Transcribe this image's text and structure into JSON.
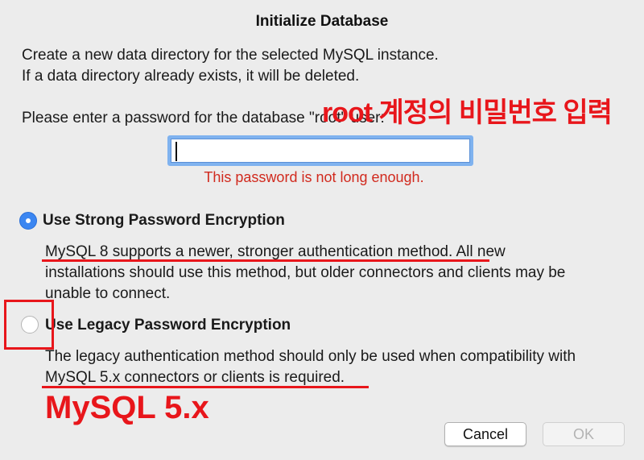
{
  "dialog": {
    "title": "Initialize Database",
    "description_line1": "Create a new data directory for the selected MySQL instance.",
    "description_line2": "If a data directory already exists, it will be deleted.",
    "password_label": "Please enter a password for the database \"root\" user:",
    "password_value": "",
    "password_error": "This password is not long enough."
  },
  "options": {
    "strong": {
      "label": "Use Strong Password Encryption",
      "selected": true,
      "line1_highlight": "MySQL 8 supports a newer, stronger authentication method.",
      "line1_rest": " All new",
      "line2": "installations should use this method, but older connectors and clients may be",
      "line3": "unable to connect."
    },
    "legacy": {
      "label": "Use Legacy Password Encryption",
      "selected": false,
      "line1": "The legacy authentication method should only be used when compatibility with",
      "line2_highlight": "MySQL 5.x connectors or clients is required."
    }
  },
  "annotations": {
    "korean_note": "root 계정의 비밀번호 입력",
    "mysql_note": "MySQL 5.x",
    "color": "#e8161b"
  },
  "buttons": {
    "cancel": "Cancel",
    "ok": "OK"
  },
  "colors": {
    "accent": "#3b86f1",
    "error": "#d12a1e",
    "background": "#ececec"
  }
}
